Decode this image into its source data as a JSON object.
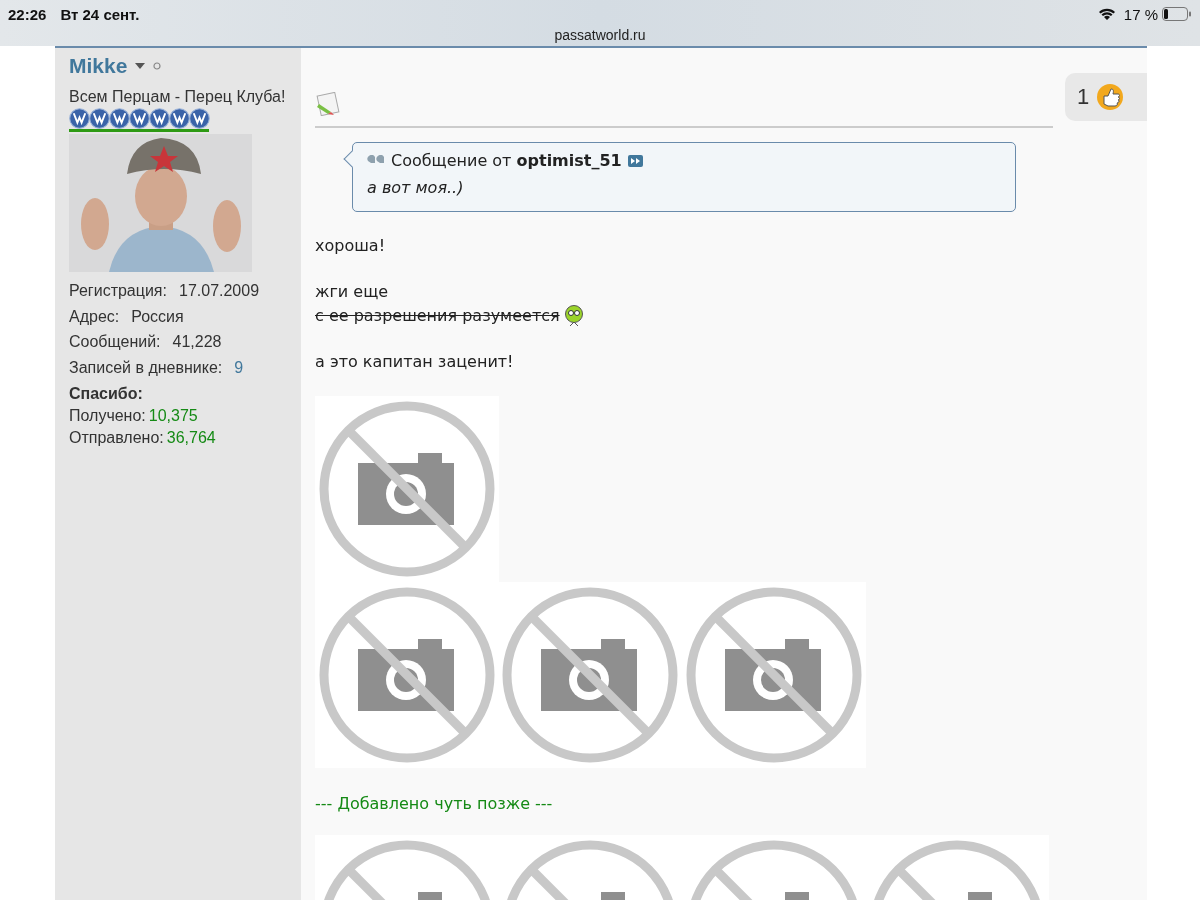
{
  "status_bar": {
    "time": "22:26",
    "date": "Вт 24 сент.",
    "battery": "17 %"
  },
  "address": "passatworld.ru",
  "user": {
    "name": "Mikke",
    "title": "Всем Перцам - Перец Клуба!",
    "stats": [
      {
        "kind": "plain",
        "label": "Регистрация:",
        "value": "17.07.2009"
      },
      {
        "kind": "plain",
        "label": "Адрес:",
        "value": "Россия"
      },
      {
        "kind": "plain",
        "label": "Сообщений:",
        "value": "41,228"
      },
      {
        "kind": "link",
        "label": "Записей в дневнике:",
        "value": "9"
      },
      {
        "kind": "heading",
        "label": "Спасибо:"
      },
      {
        "kind": "thanks",
        "label": "Получено:",
        "value": "10,375"
      },
      {
        "kind": "thanks",
        "label": "Отправлено:",
        "value": "36,764"
      }
    ]
  },
  "post": {
    "thanks_count": "1",
    "quote": {
      "prefix": "Сообщение от",
      "author": "optimist_51",
      "text": "а вот моя..)"
    },
    "blocks": [
      {
        "kind": "text",
        "lines": [
          "хороша!"
        ]
      },
      {
        "kind": "text",
        "lines": [
          "жги еще"
        ],
        "struck": "с ее разрешения разумеется"
      },
      {
        "kind": "text",
        "lines": [
          "а это капитан заценит!"
        ]
      },
      {
        "kind": "images",
        "images": [
          {
            "kind": "unavailable"
          }
        ]
      },
      {
        "kind": "images",
        "images": [
          {
            "kind": "unavailable"
          },
          {
            "kind": "unavailable"
          },
          {
            "kind": "unavailable"
          }
        ]
      },
      {
        "kind": "added",
        "text": "--- Добавлено чуть позже ---"
      },
      {
        "kind": "images",
        "images": [
          {
            "kind": "unavailable"
          },
          {
            "kind": "unavailable"
          },
          {
            "kind": "unavailable"
          },
          {
            "kind": "unavailable"
          }
        ]
      }
    ]
  }
}
